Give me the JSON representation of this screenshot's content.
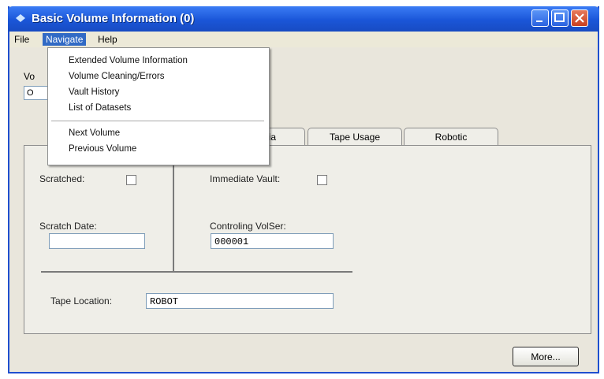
{
  "window": {
    "title": "Basic Volume Information (0)"
  },
  "menubar": {
    "items": [
      "File",
      "Navigate",
      "Help"
    ],
    "active": "Navigate"
  },
  "navigate_menu": {
    "group1": [
      "Extended Volume Information",
      "Volume Cleaning/Errors",
      "Vault History",
      "List of Datasets"
    ],
    "group2": [
      "Next Volume",
      "Previous Volume"
    ]
  },
  "partial": {
    "vol_label": "Vo",
    "vol_value": "O"
  },
  "tabs": [
    "dia",
    "Tape Usage",
    "Robotic"
  ],
  "form": {
    "scratched_label": "Scratched:",
    "scratch_date_label": "Scratch Date:",
    "scratch_date_value": "",
    "immediate_vault_label": "Immediate Vault:",
    "controlling_volser_label": "Controling VolSer:",
    "controlling_volser_value": "000001",
    "tape_location_label": "Tape Location:",
    "tape_location_value": "ROBOT"
  },
  "buttons": {
    "more": "More..."
  },
  "colors": {
    "titlebar": "#1a56d8",
    "menu_highlight": "#316ac5",
    "window_bg": "#e9e6dc"
  }
}
